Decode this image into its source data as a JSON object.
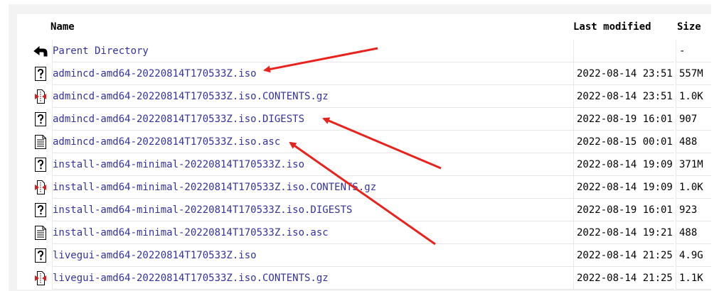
{
  "columns": {
    "name": "Name",
    "last_modified": "Last modified",
    "size": "Size"
  },
  "parent": {
    "label": "Parent Directory",
    "size": "-",
    "icon": "back-icon"
  },
  "files": [
    {
      "name": "admincd-amd64-20220814T170533Z.iso",
      "modified": "2022-08-14 23:51",
      "size": "557M",
      "icon": "unknown-file-icon"
    },
    {
      "name": "admincd-amd64-20220814T170533Z.iso.CONTENTS.gz",
      "modified": "2022-08-14 23:51",
      "size": "1.0K",
      "icon": "compressed-file-icon"
    },
    {
      "name": "admincd-amd64-20220814T170533Z.iso.DIGESTS",
      "modified": "2022-08-19 16:01",
      "size": "907",
      "icon": "unknown-file-icon"
    },
    {
      "name": "admincd-amd64-20220814T170533Z.iso.asc",
      "modified": "2022-08-15 00:01",
      "size": "488",
      "icon": "text-file-icon"
    },
    {
      "name": "install-amd64-minimal-20220814T170533Z.iso",
      "modified": "2022-08-14 19:09",
      "size": "371M",
      "icon": "unknown-file-icon"
    },
    {
      "name": "install-amd64-minimal-20220814T170533Z.iso.CONTENTS.gz",
      "modified": "2022-08-14 19:09",
      "size": "1.0K",
      "icon": "compressed-file-icon"
    },
    {
      "name": "install-amd64-minimal-20220814T170533Z.iso.DIGESTS",
      "modified": "2022-08-19 16:01",
      "size": "923",
      "icon": "unknown-file-icon"
    },
    {
      "name": "install-amd64-minimal-20220814T170533Z.iso.asc",
      "modified": "2022-08-14 19:21",
      "size": "488",
      "icon": "text-file-icon"
    },
    {
      "name": "livegui-amd64-20220814T170533Z.iso",
      "modified": "2022-08-14 21:25",
      "size": "4.9G",
      "icon": "unknown-file-icon"
    },
    {
      "name": "livegui-amd64-20220814T170533Z.iso.CONTENTS.gz",
      "modified": "2022-08-14 21:25",
      "size": "1.1K",
      "icon": "compressed-file-icon"
    }
  ],
  "colors": {
    "link": "#33339a",
    "annotation_arrow": "#e8231d",
    "row_border": "#e6e6e6",
    "frame": "#f3f3f3"
  }
}
